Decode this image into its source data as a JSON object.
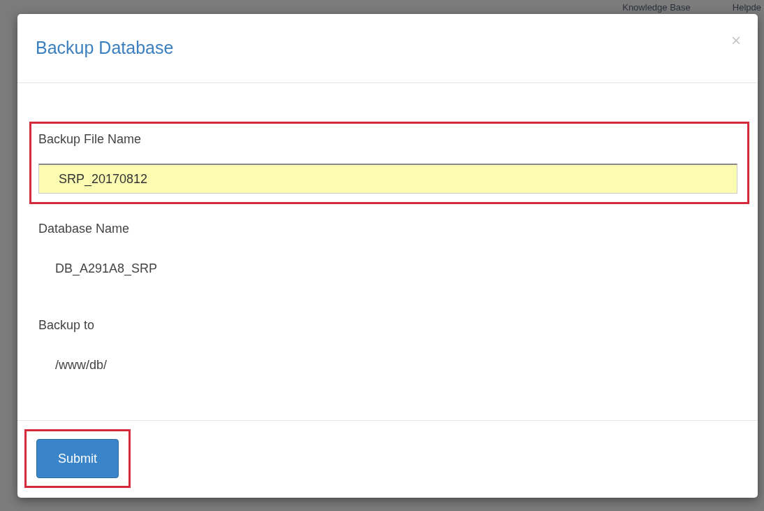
{
  "background_nav": [
    "Knowledge Base",
    "Helpde"
  ],
  "dialog": {
    "title": "Backup Database",
    "close": "×",
    "fields": [
      {
        "kind": "input",
        "label": "Backup File Name",
        "value": "SRP_20170812",
        "highlighted": true
      },
      {
        "kind": "static",
        "label": "Database Name",
        "value": "DB_A291A8_SRP",
        "highlighted": false
      },
      {
        "kind": "static",
        "label": "Backup to",
        "value": "/www/db/",
        "highlighted": false
      }
    ],
    "submit": {
      "label": "Submit",
      "highlighted": true
    }
  }
}
